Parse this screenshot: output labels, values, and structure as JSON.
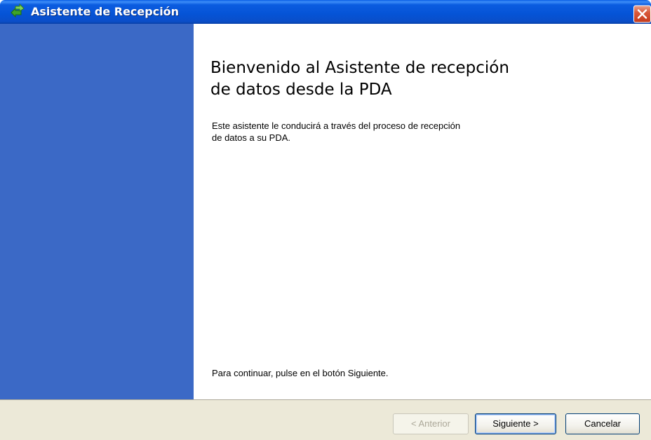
{
  "window": {
    "title": "Asistente de Recepción",
    "title_icon": "green-sync-arrows-icon",
    "close_icon": "close-icon"
  },
  "content": {
    "heading": "Bienvenido al Asistente de recepción\nde datos desde la PDA",
    "description": "Este asistente le conducirá a través del proceso de recepción\nde datos a su PDA.",
    "hint": "Para continuar, pulse en el botón Siguiente."
  },
  "footer": {
    "back_label": "< Anterior",
    "back_enabled": false,
    "next_label": "Siguiente >",
    "cancel_label": "Cancelar"
  },
  "colors": {
    "titlebar": "#0553d6",
    "sidebar": "#3b69c6",
    "footer": "#ece9d8",
    "close": "#c63c1c"
  }
}
